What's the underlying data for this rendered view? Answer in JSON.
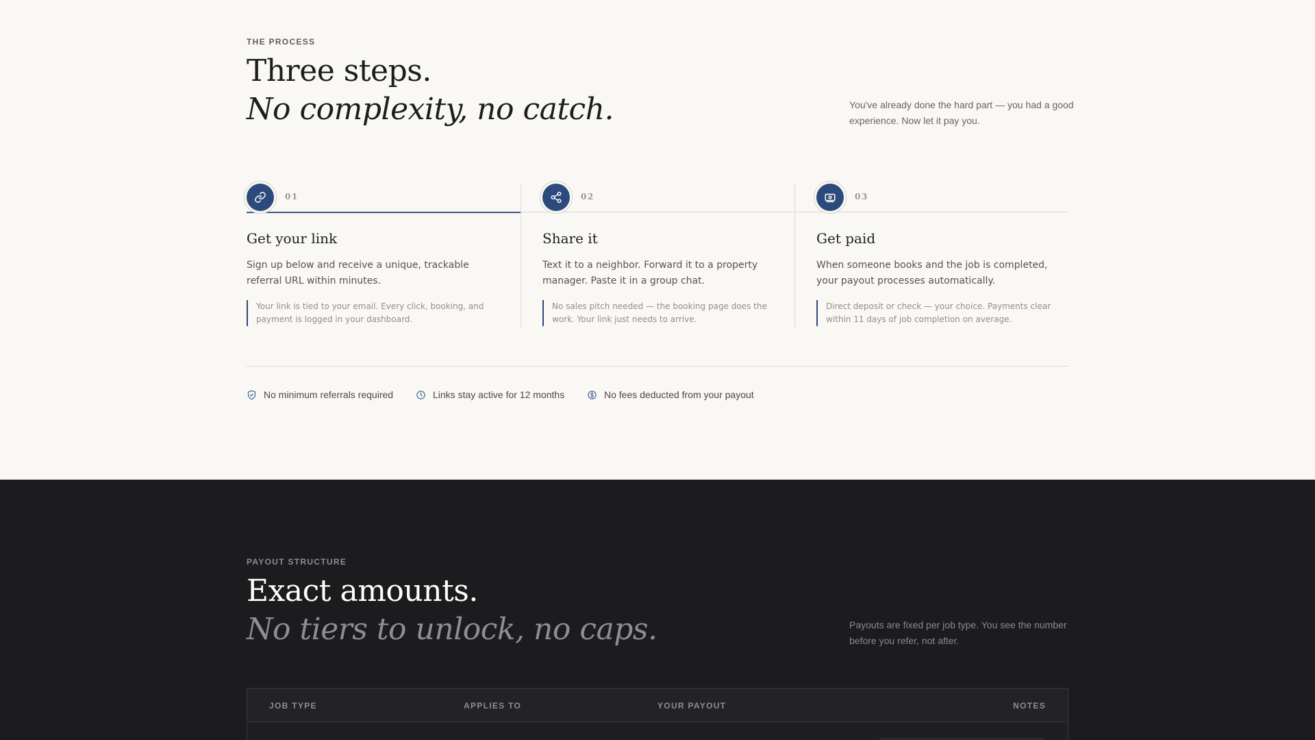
{
  "process": {
    "eyebrow": "THE PROCESS",
    "headline": "Three steps.",
    "headline_italic": "No complexity, no catch.",
    "side_note": "You've already done the hard part — you had a good experience. Now let it pay you.",
    "steps": [
      {
        "number": "01",
        "icon": "link-icon",
        "title": "Get your link",
        "description": "Sign up below and receive a unique, trackable referral URL within minutes.",
        "note": "Your link is tied to your email. Every click, booking, and payment is logged in your dashboard."
      },
      {
        "number": "02",
        "icon": "share-icon",
        "title": "Share it",
        "description": "Text it to a neighbor. Forward it to a property manager. Paste it in a group chat.",
        "note": "No sales pitch needed — the booking page does the work. Your link just needs to arrive."
      },
      {
        "number": "03",
        "icon": "cash-icon",
        "title": "Get paid",
        "description": "When someone books and the job is completed, your payout processes automatically.",
        "note": "Direct deposit or check — your choice. Payments clear within 11 days of job completion on average."
      }
    ],
    "features": [
      {
        "icon": "shield-check-icon",
        "label": "No minimum referrals required"
      },
      {
        "icon": "clock-icon",
        "label": "Links stay active for 12 months"
      },
      {
        "icon": "dollar-icon",
        "label": "No fees deducted from your payout"
      }
    ]
  },
  "payout": {
    "eyebrow": "PAYOUT STRUCTURE",
    "headline": "Exact amounts.",
    "headline_italic": "No tiers to unlock, no caps.",
    "side_note": "Payouts are fixed per job type. You see the number before you refer, not after.",
    "table": {
      "columns": [
        "JOB TYPE",
        "APPLIES TO",
        "YOUR PAYOUT",
        "NOTES"
      ]
    }
  },
  "colors": {
    "accent": "#2c4a7c",
    "light_bg": "#f9f8f4",
    "dark_bg": "#1c1c1e"
  }
}
